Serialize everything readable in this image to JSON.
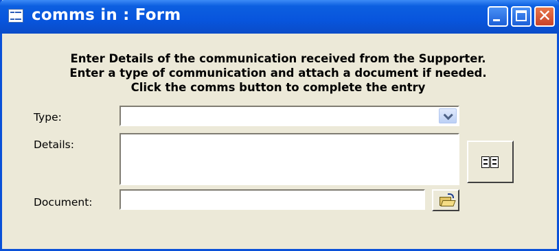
{
  "window": {
    "title": "comms in : Form",
    "controls": {
      "minimize": "minimize",
      "maximize": "maximize",
      "close": "close"
    }
  },
  "instructions": {
    "line1": "Enter Details of the communication received from the Supporter.",
    "line2": "Enter a type of communication and attach a document if needed.",
    "line3": "Click the comms button to complete the entry"
  },
  "form": {
    "type_label": "Type:",
    "type_value": "",
    "details_label": "Details:",
    "details_value": "",
    "document_label": "Document:",
    "document_value": ""
  },
  "icons": {
    "title": "form-icon",
    "comms": "book-icon",
    "browse": "open-folder-icon",
    "dropdown": "chevron-down-icon"
  },
  "colors": {
    "titlebar": "#0855dd",
    "window_bg": "#ece9d8",
    "close_button": "#d9572e"
  }
}
